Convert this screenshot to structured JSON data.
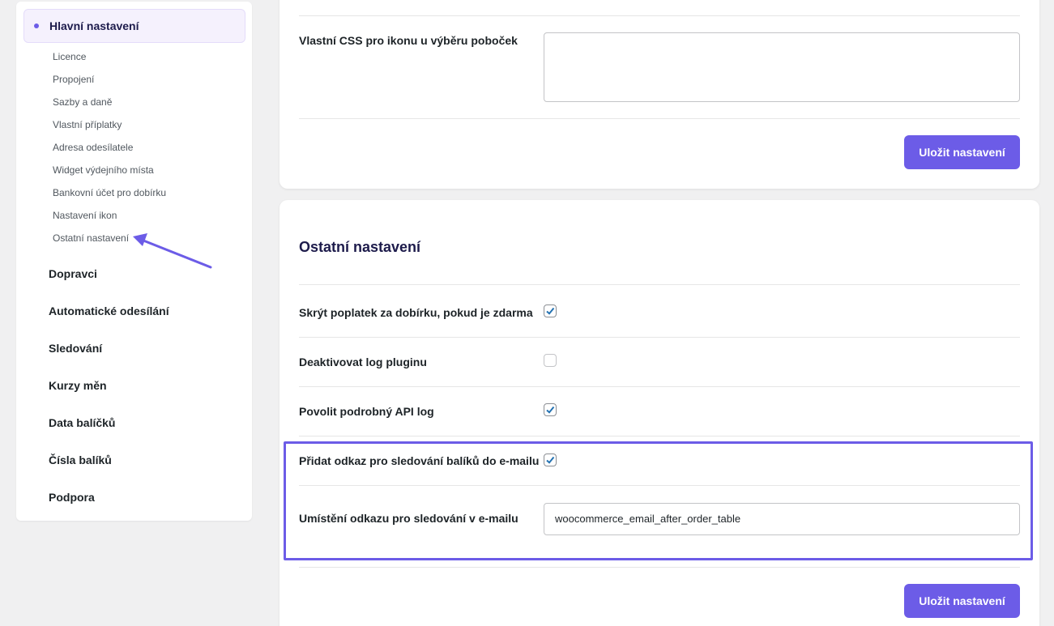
{
  "colors": {
    "accent": "#6c5ce7",
    "highlight": "#6c5ce7",
    "checkmark": "#2271b1"
  },
  "sidebar": {
    "active_section": "Hlavní nastavení",
    "sub_items": [
      "Licence",
      "Propojení",
      "Sazby a daně",
      "Vlastní příplatky",
      "Adresa odesílatele",
      "Widget výdejního místa",
      "Bankovní účet pro dobírku",
      "Nastavení ikon",
      "Ostatní nastavení"
    ],
    "main_items": [
      "Dopravci",
      "Automatické odesílání",
      "Sledování",
      "Kurzy měn",
      "Data balíčků",
      "Čísla balíků",
      "Podpora"
    ]
  },
  "card1": {
    "css_label": "Vlastní CSS pro ikonu u výběru poboček",
    "css_value": "",
    "save_label": "Uložit nastavení"
  },
  "card2": {
    "title": "Ostatní nastavení",
    "rows": [
      {
        "label": "Skrýt poplatek za dobírku, pokud je zdarma",
        "checked": true
      },
      {
        "label": "Deaktivovat log pluginu",
        "checked": false
      },
      {
        "label": "Povolit podrobný API log",
        "checked": true
      },
      {
        "label": "Přidat odkaz pro sledování balíků do e-mailu",
        "checked": true
      }
    ],
    "placement_label": "Umístění odkazu pro sledování v e-mailu",
    "placement_value": "woocommerce_email_after_order_table",
    "save_label": "Uložit nastavení"
  }
}
